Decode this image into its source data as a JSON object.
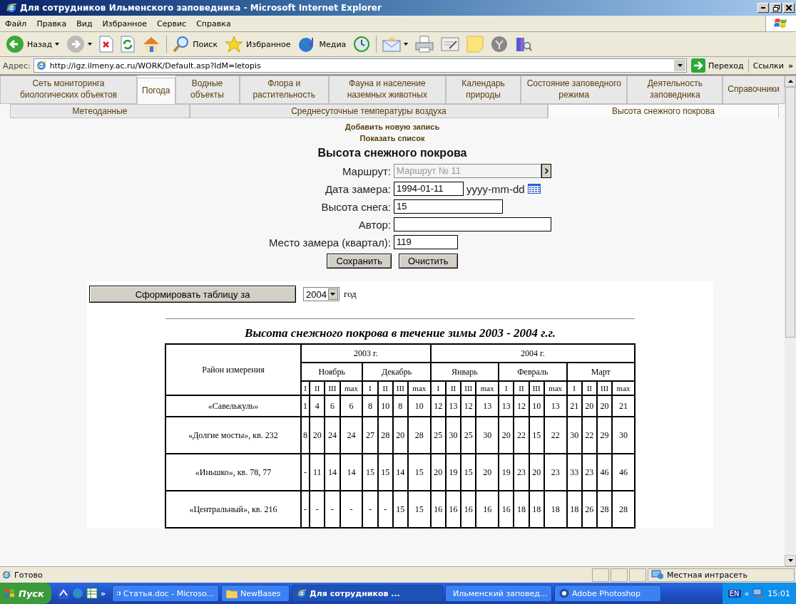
{
  "window": {
    "title": "Для сотрудников Ильменского заповедника - Microsoft Internet Explorer"
  },
  "menu": [
    "Файл",
    "Правка",
    "Вид",
    "Избранное",
    "Сервис",
    "Справка"
  ],
  "toolbar": [
    {
      "kind": "back",
      "label": "Назад",
      "dropdown": true
    },
    {
      "kind": "forward",
      "dropdown": true
    },
    {
      "kind": "stop",
      "dropdown": false
    },
    {
      "kind": "refresh",
      "dropdown": false
    },
    {
      "kind": "home",
      "dropdown": false
    },
    {
      "kind": "search",
      "label": "Поиск",
      "dropdown": false
    },
    {
      "kind": "favorites",
      "label": "Избранное",
      "dropdown": false
    },
    {
      "kind": "media",
      "label": "Медиа",
      "dropdown": false
    },
    {
      "kind": "history",
      "dropdown": false
    },
    {
      "kind": "mail",
      "dropdown": true
    },
    {
      "kind": "print",
      "dropdown": false
    },
    {
      "kind": "edit",
      "dropdown": false
    },
    {
      "kind": "note",
      "dropdown": false
    },
    {
      "kind": "messenger",
      "dropdown": false
    },
    {
      "kind": "research",
      "dropdown": false
    }
  ],
  "address": {
    "label": "Адрес:",
    "url": "http://igz.ilmeny.ac.ru/WORK/Default.asp?IdM=letopis",
    "go": "Переход",
    "links": "Ссылки",
    "more": "»"
  },
  "tabs": [
    {
      "label": "Сеть мониторинга биологических объектов",
      "selected": false
    },
    {
      "label": "Погода",
      "selected": true
    },
    {
      "label": "Водные объекты",
      "selected": false
    },
    {
      "label": "Флора и растительность",
      "selected": false
    },
    {
      "label": "Фауна и население наземных животных",
      "selected": false
    },
    {
      "label": "Календарь природы",
      "selected": false
    },
    {
      "label": "Состояние заповедного режима",
      "selected": false
    },
    {
      "label": "Деятельность заповедника",
      "selected": false
    },
    {
      "label": "Справочники",
      "selected": false
    }
  ],
  "subtabs": [
    {
      "label": "Метеоданные",
      "selected": false
    },
    {
      "label": "Среднесуточные температуры воздуха",
      "selected": false
    },
    {
      "label": "Высота снежного покрова",
      "selected": true
    }
  ],
  "links": [
    "Добавить новую запись",
    "Показать список"
  ],
  "form": {
    "heading": "Высота снежного покрова",
    "fields": [
      {
        "kind": "picker",
        "label": "Маршрут:",
        "value": "Маршрут № 11",
        "disabled": true
      },
      {
        "kind": "date",
        "label": "Дата замера:",
        "value": "1994-01-11",
        "format": "yyyy-mm-dd",
        "disabled": false
      },
      {
        "kind": "text",
        "label": "Высота снега:",
        "value": "15",
        "disabled": false
      },
      {
        "kind": "text",
        "label": "Автор:",
        "disabled": false
      },
      {
        "kind": "short",
        "label": "Место замера (квартал):",
        "value": "119",
        "disabled": false
      }
    ],
    "buttons": [
      "Сохранить",
      "Очистить"
    ]
  },
  "report": {
    "button": "Сформировать таблицу  за",
    "year": "2004",
    "year_suffix": "год"
  },
  "table": {
    "title": "Высота снежного покрова в течение зимы 2003 - 2004 г.г.",
    "row_header": "Район измерения",
    "years": [
      {
        "label": "2003 г.",
        "months": [
          {
            "label": "Ноябрь",
            "decades": [
              "I",
              "II",
              "III",
              "max"
            ]
          },
          {
            "label": "Декабрь",
            "decades": [
              "I",
              "II",
              "III",
              "max"
            ]
          }
        ]
      },
      {
        "label": "2004 г.",
        "months": [
          {
            "label": "Январь",
            "decades": [
              "I",
              "II",
              "III",
              "max"
            ]
          },
          {
            "label": "Февраль",
            "decades": [
              "I",
              "II",
              "III",
              "max"
            ]
          },
          {
            "label": "Март",
            "decades": [
              "I",
              "II",
              "III",
              "max"
            ]
          }
        ]
      }
    ],
    "rows": [
      {
        "name": "«Савелькуль»",
        "values": [
          "1",
          "4",
          "6",
          "6",
          "8",
          "10",
          "8",
          "10",
          "12",
          "13",
          "12",
          "13",
          "13",
          "12",
          "10",
          "13",
          "21",
          "20",
          "20",
          "21"
        ]
      },
      {
        "name": "«Долгие мосты», кв. 232",
        "values": [
          "8",
          "20",
          "24",
          "24",
          "27",
          "28",
          "20",
          "28",
          "25",
          "30",
          "25",
          "30",
          "20",
          "22",
          "15",
          "22",
          "30",
          "22",
          "29",
          "30"
        ]
      },
      {
        "name": "«Иньшко», кв. 78, 77",
        "values": [
          "-",
          "11",
          "14",
          "14",
          "15",
          "15",
          "14",
          "15",
          "20",
          "19",
          "15",
          "20",
          "19",
          "23",
          "20",
          "23",
          "33",
          "23",
          "46",
          "46"
        ]
      },
      {
        "name": "«Центральный», кв. 216",
        "values": [
          "-",
          "-",
          "-",
          "-",
          "-",
          "-",
          "15",
          "15",
          "16",
          "16",
          "16",
          "16",
          "16",
          "18",
          "18",
          "18",
          "18",
          "26",
          "28",
          "28"
        ]
      }
    ]
  },
  "status_bar": {
    "text": "Готово",
    "zone": "Местная интрасеть"
  },
  "taskbar": {
    "start": "Пуск",
    "more": "»",
    "tasks": [
      {
        "kind": "word",
        "label": "Статья.doc - Microso...",
        "selected": false
      },
      {
        "kind": "folder",
        "label": "NewBases",
        "selected": false
      },
      {
        "kind": "ie",
        "label": "Для сотрудников ...",
        "selected": true
      },
      {
        "kind": "word",
        "label": "Ильменский заповед...",
        "selected": false
      },
      {
        "kind": "photoshop",
        "label": "Adobe Photoshop",
        "selected": false
      }
    ],
    "lang": "EN",
    "expand": "«",
    "clock": "15:01"
  }
}
